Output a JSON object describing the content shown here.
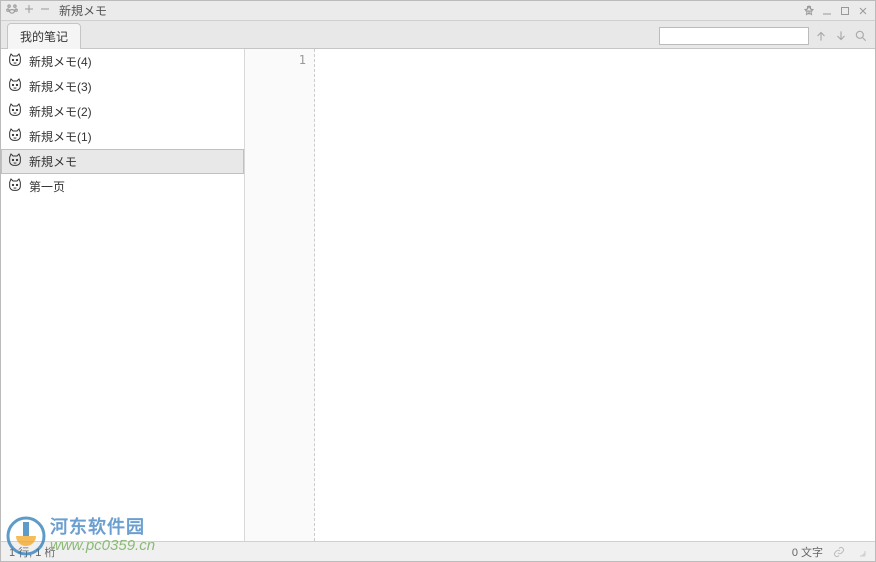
{
  "window": {
    "title": "新規メモ"
  },
  "tabs": [
    {
      "label": "我的笔记"
    }
  ],
  "search": {
    "value": ""
  },
  "sidebar": {
    "items": [
      {
        "label": "新規メモ(4)",
        "selected": false
      },
      {
        "label": "新規メモ(3)",
        "selected": false
      },
      {
        "label": "新規メモ(2)",
        "selected": false
      },
      {
        "label": "新規メモ(1)",
        "selected": false
      },
      {
        "label": "新規メモ",
        "selected": true
      },
      {
        "label": "第一页",
        "selected": false
      }
    ]
  },
  "editor": {
    "line_number": "1",
    "content": ""
  },
  "statusbar": {
    "left": "1 行, 1 桁",
    "right": "0 文字"
  },
  "watermark": {
    "line1": "河东软件园",
    "line2": "www.pc0359.cn"
  }
}
